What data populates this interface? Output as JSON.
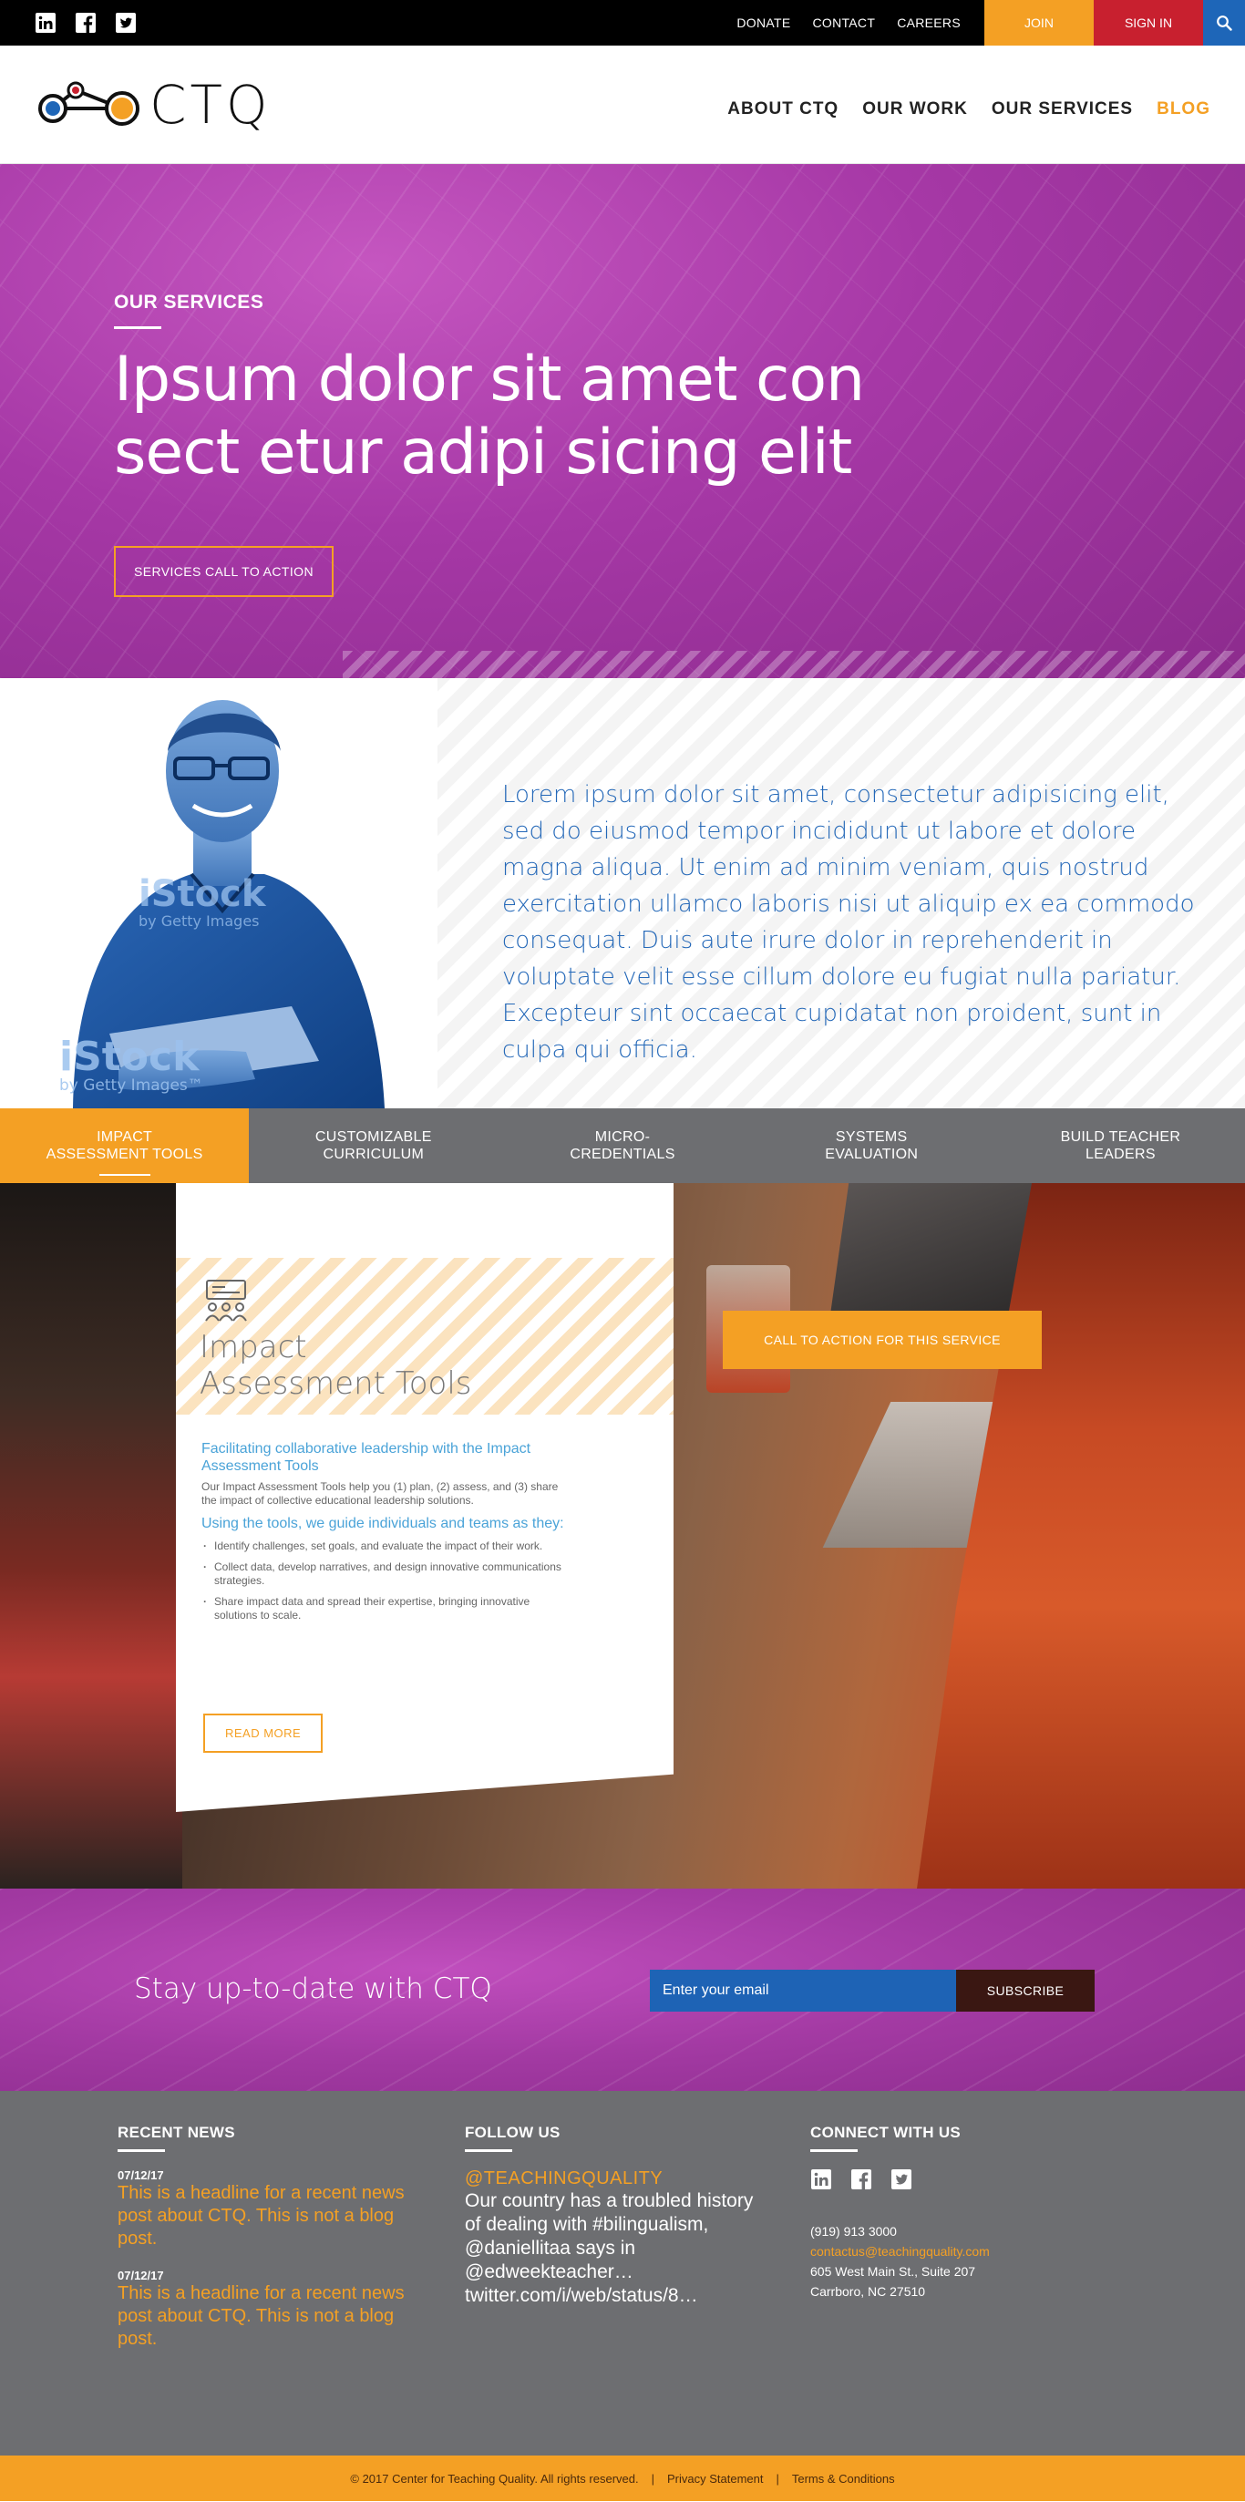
{
  "topbar": {
    "social": [
      {
        "icon": "linkedin-icon"
      },
      {
        "icon": "facebook-icon"
      },
      {
        "icon": "twitter-icon"
      }
    ],
    "links": [
      "DONATE",
      "CONTACT",
      "CAREERS"
    ],
    "join": "JOIN",
    "signin": "SIGN IN",
    "search_icon": "search-icon"
  },
  "header": {
    "logo_text": "CTQ",
    "nav": [
      "ABOUT CTQ",
      "OUR WORK",
      "OUR SERVICES",
      "BLOG"
    ]
  },
  "hero": {
    "eyebrow": "OUR SERVICES",
    "title_line1": "Ipsum dolor sit amet con",
    "title_line2": "sect etur adipi sicing elit",
    "cta": "SERVICES CALL TO ACTION"
  },
  "intro": {
    "text": "Lorem ipsum dolor sit amet, consectetur adipisicing elit, sed do eiusmod tempor incididunt ut labore et dolore magna aliqua. Ut enim ad minim veniam, quis nostrud exercitation ullamco laboris nisi ut aliquip ex ea commodo consequat. Duis aute irure dolor in reprehenderit in voluptate velit esse cillum dolore eu fugiat nulla pariatur. Excepteur sint occaecat cupidatat non proident, sunt in culpa qui officia.",
    "watermark1": "iStock",
    "watermark1_sub": "by Getty Images",
    "watermark2": "iStock",
    "watermark2_sub": "by Getty Images™"
  },
  "tabs": [
    {
      "line1": "IMPACT",
      "line2": "ASSESSMENT TOOLS",
      "active": true
    },
    {
      "line1": "CUSTOMIZABLE",
      "line2": "CURRICULUM",
      "active": false
    },
    {
      "line1": "MICRO-",
      "line2": "CREDENTIALS",
      "active": false
    },
    {
      "line1": "SYSTEMS",
      "line2": "EVALUATION",
      "active": false
    },
    {
      "line1": "BUILD TEACHER",
      "line2": "LEADERS",
      "active": false
    }
  ],
  "service": {
    "title_line1": "Impact",
    "title_line2": "Assessment Tools",
    "lead": "Facilitating collaborative leadership with the Impact Assessment Tools",
    "paragraph": "Our Impact Assessment Tools help you (1) plan, (2) assess, and (3) share the impact of collective educational leadership solutions.",
    "subhead": "Using the tools, we guide individuals and teams as they:",
    "bullets": [
      "Identify challenges, set goals, and evaluate the impact of their work.",
      "Collect data, develop narratives, and design innovative communications strategies.",
      "Share impact data and spread their expertise, bringing innovative solutions to scale."
    ],
    "read_more": "READ MORE",
    "cta": "CALL TO ACTION FOR THIS SERVICE"
  },
  "newsletter": {
    "title": "Stay up-to-date with CTQ",
    "placeholder": "Enter your email",
    "button": "SUBSCRIBE"
  },
  "footer": {
    "news_heading": "RECENT NEWS",
    "news": [
      {
        "date": "07/12/17",
        "headline": "This is a headline for a recent news post about CTQ. This is not a blog post."
      },
      {
        "date": "07/12/17",
        "headline": "This is a headline for a recent news post about CTQ. This is not a blog post."
      }
    ],
    "follow_heading": "FOLLOW US",
    "twitter_handle": "@TEACHINGQUALITY",
    "tweet": "Our country has a troubled history of dealing with #bilingualism, @daniellitaa says in @edweekteacher… twitter.com/i/web/status/8…",
    "connect_heading": "CONNECT WITH US",
    "phone": "(919) 913 3000",
    "email": "contactus@teachingquality.com",
    "address1": "605 West Main St., Suite 207",
    "address2": "Carrboro, NC 27510"
  },
  "bottombar": {
    "copyright": "© 2017 Center for Teaching Quality. All rights reserved.",
    "sep": "|",
    "privacy": "Privacy Statement",
    "terms": "Terms & Conditions"
  },
  "colors": {
    "orange": "#f4a024",
    "purple": "#a638a6",
    "blue": "#1e66b8",
    "red": "#c8202f",
    "gray": "#6d6e71"
  }
}
